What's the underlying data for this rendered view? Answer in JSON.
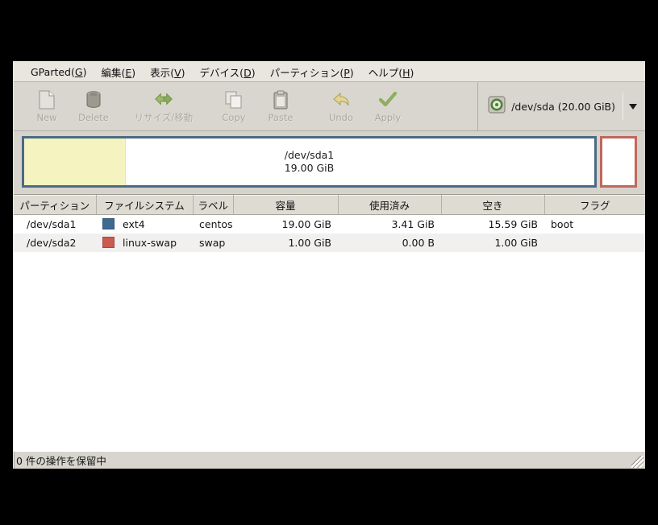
{
  "window": {
    "menu": [
      {
        "label": "GParted",
        "mnemonic": "G",
        "name": "menu-gparted"
      },
      {
        "label": "編集",
        "mnemonic": "E",
        "name": "menu-edit"
      },
      {
        "label": "表示",
        "mnemonic": "V",
        "name": "menu-view"
      },
      {
        "label": "デバイス",
        "mnemonic": "D",
        "name": "menu-device"
      },
      {
        "label": "パーティション",
        "mnemonic": "P",
        "name": "menu-partition"
      },
      {
        "label": "ヘルプ",
        "mnemonic": "H",
        "name": "menu-help"
      }
    ]
  },
  "toolbar": {
    "new_label": "New",
    "delete_label": "Delete",
    "resize_label": "リサイズ/移動",
    "copy_label": "Copy",
    "paste_label": "Paste",
    "undo_label": "Undo",
    "apply_label": "Apply",
    "device_label": "/dev/sda  (20.00 GiB)",
    "device_icon": "hard-disk-icon",
    "dropdown_icon": "chevron-down-icon"
  },
  "graphic": {
    "sda1_name": "/dev/sda1",
    "sda1_size": "19.00 GiB",
    "sda1_border_color": "#4c6a84",
    "sda1_used_color": "#f5f3bf",
    "sda1_free_color": "#ffffff",
    "sda1_used_percent": 17.8,
    "sda2_border_color": "#c1675c",
    "sda2_fill_color": "#ffffff"
  },
  "table": {
    "headers": [
      "パーティション",
      "ファイルシステム",
      "ラベル",
      "容量",
      "使用済み",
      "空き",
      "フラグ"
    ],
    "rows": [
      {
        "partition": "/dev/sda1",
        "filesystem": "ext4",
        "fs_color": "#3d6a91",
        "label": "centos",
        "size": "19.00 GiB",
        "used": "3.41 GiB",
        "unused": "15.59 GiB",
        "flags": "boot"
      },
      {
        "partition": "/dev/sda2",
        "filesystem": "linux-swap",
        "fs_color": "#cb5a50",
        "label": "swap",
        "size": "1.00 GiB",
        "used": "0.00 B",
        "unused": "1.00 GiB",
        "flags": ""
      }
    ]
  },
  "statusbar": {
    "text": "0 件の操作を保留中",
    "grip_icon": "resize-grip-icon"
  }
}
